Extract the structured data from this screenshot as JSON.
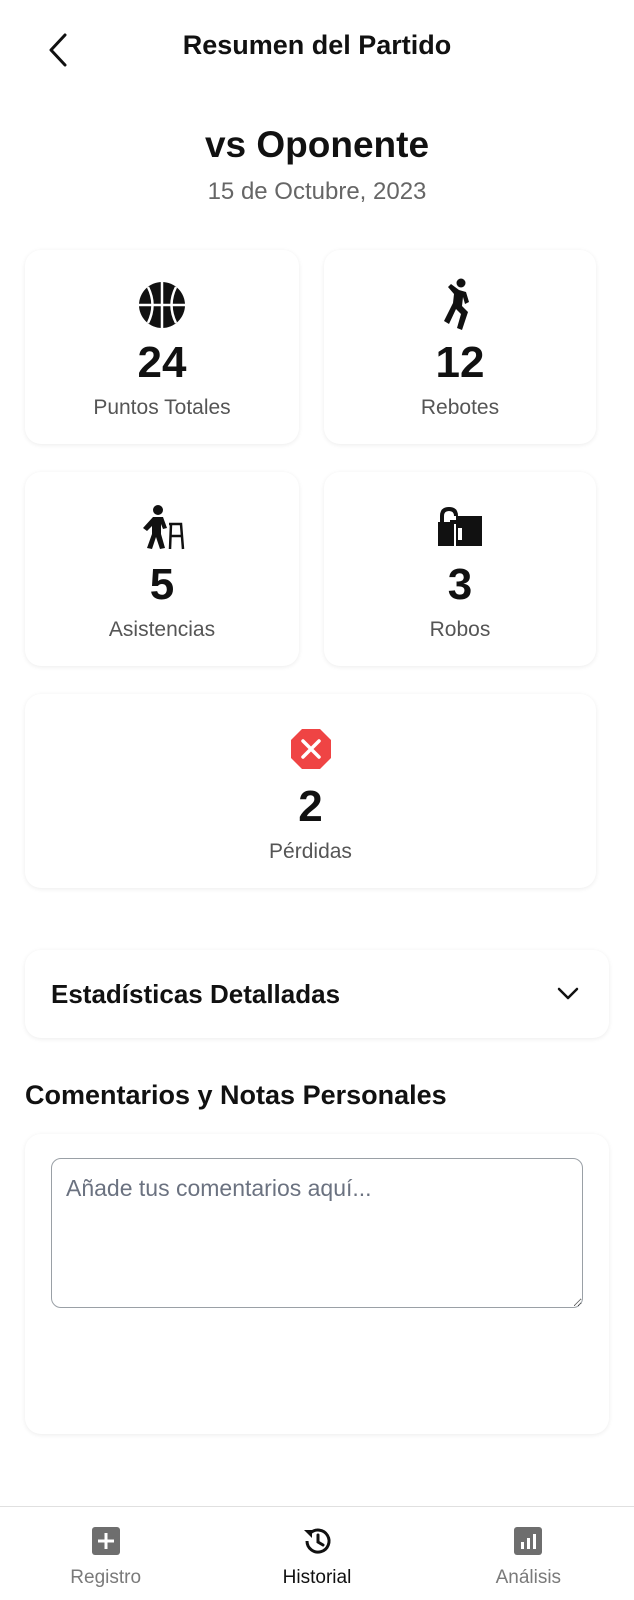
{
  "header": {
    "title": "Resumen del Partido",
    "back_icon": "chevron-left-icon"
  },
  "match": {
    "opponent": "vs Oponente",
    "date": "15 de Octubre, 2023"
  },
  "stats": [
    {
      "icon": "basketball-icon",
      "value": "24",
      "label": "Puntos Totales"
    },
    {
      "icon": "jumping-player-icon",
      "value": "12",
      "label": "Rebotes"
    },
    {
      "icon": "assist-person-icon",
      "value": "5",
      "label": "Asistencias"
    },
    {
      "icon": "open-lock-icon",
      "value": "3",
      "label": "Robos"
    },
    {
      "icon": "error-octagon-icon",
      "value": "2",
      "label": "Pérdidas",
      "accent": "#ef4444"
    }
  ],
  "details": {
    "title": "Estadísticas Detalladas",
    "icon": "chevron-down-icon"
  },
  "comments": {
    "title": "Comentarios y Notas Personales",
    "placeholder": "Añade tus comentarios aquí...",
    "value": ""
  },
  "nav": {
    "items": [
      {
        "label": "Registro",
        "icon": "add-box-icon",
        "active": false
      },
      {
        "label": "Historial",
        "icon": "history-icon",
        "active": true
      },
      {
        "label": "Análisis",
        "icon": "analytics-icon",
        "active": false
      }
    ],
    "active_color": "#111111",
    "inactive_color": "#7a7a7a"
  }
}
